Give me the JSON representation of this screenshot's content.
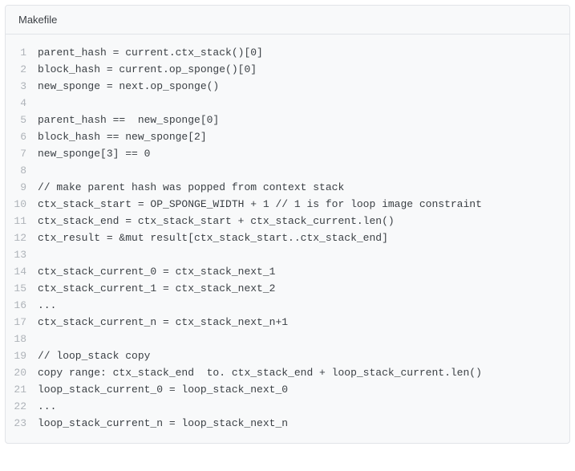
{
  "header": {
    "language": "Makefile"
  },
  "code": {
    "lines": [
      "parent_hash = current.ctx_stack()[0]",
      "block_hash = current.op_sponge()[0]",
      "new_sponge = next.op_sponge()",
      "",
      "parent_hash ==  new_sponge[0]",
      "block_hash == new_sponge[2]",
      "new_sponge[3] == 0",
      "",
      "// make parent hash was popped from context stack",
      "ctx_stack_start = OP_SPONGE_WIDTH + 1 // 1 is for loop image constraint",
      "ctx_stack_end = ctx_stack_start + ctx_stack_current.len()",
      "ctx_result = &mut result[ctx_stack_start..ctx_stack_end]",
      "",
      "ctx_stack_current_0 = ctx_stack_next_1",
      "ctx_stack_current_1 = ctx_stack_next_2",
      "...",
      "ctx_stack_current_n = ctx_stack_next_n+1",
      "",
      "// loop_stack copy",
      "copy range: ctx_stack_end  to. ctx_stack_end + loop_stack_current.len()",
      "loop_stack_current_0 = loop_stack_next_0",
      "...",
      "loop_stack_current_n = loop_stack_next_n"
    ]
  }
}
